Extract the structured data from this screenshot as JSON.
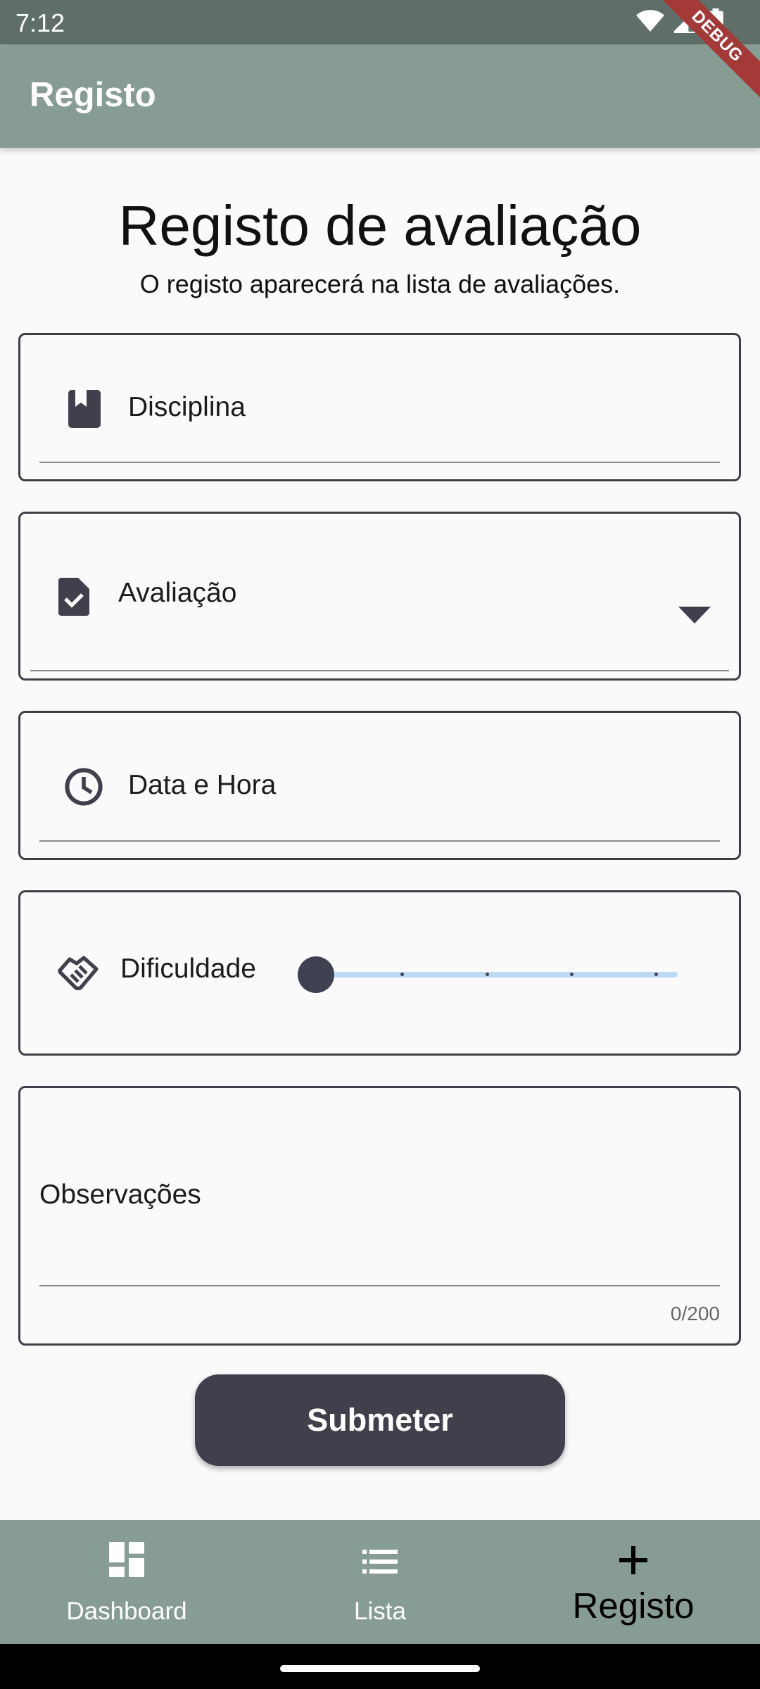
{
  "status_bar": {
    "time": "7:12"
  },
  "app_bar": {
    "title": "Registo",
    "debug_label": "DEBUG"
  },
  "page": {
    "title": "Registo de avaliação",
    "subtitle": "O registo aparecerá na lista de avaliações."
  },
  "form": {
    "disciplina": {
      "label": "Disciplina",
      "icon": "book-icon"
    },
    "avaliacao": {
      "label": "Avaliação",
      "icon": "task-icon",
      "dropdown_icon": "arrow-drop-down-icon"
    },
    "data_hora": {
      "label": "Data e Hora",
      "icon": "clock-icon"
    },
    "dificuldade": {
      "label": "Dificuldade",
      "icon": "handshake-icon",
      "value": 1,
      "min": 1,
      "max": 5
    },
    "observacoes": {
      "label": "Observações",
      "counter": "0/200"
    },
    "submit_label": "Submeter"
  },
  "bottom_nav": {
    "items": [
      {
        "label": "Dashboard",
        "icon": "dashboard-icon",
        "active": false
      },
      {
        "label": "Lista",
        "icon": "list-icon",
        "active": false
      },
      {
        "label": "Registo",
        "icon": "add-icon",
        "active": true
      }
    ]
  },
  "colors": {
    "app_bar": "#879d94",
    "status_bar": "#5f6e68",
    "accent_dark": "#3f404c",
    "slider_track": "#bcdaf5",
    "debug_ribbon": "#a33a38"
  }
}
